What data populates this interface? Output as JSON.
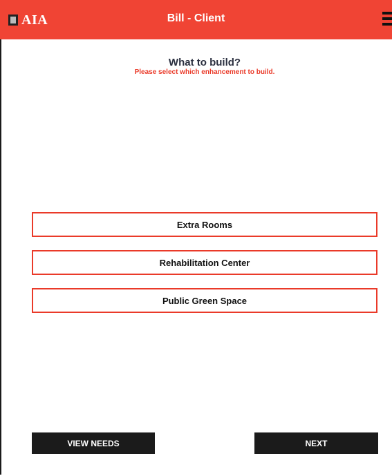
{
  "header": {
    "logo_text": "AIA",
    "title": "Bill - Client",
    "menu_icon": "hamburger-menu-icon",
    "background_color": "#f04434"
  },
  "prompt": {
    "heading": "What to build?",
    "subheading": "Please select which enhancement to build."
  },
  "options": [
    {
      "label": "Extra Rooms"
    },
    {
      "label": "Rehabilitation Center"
    },
    {
      "label": "Public Green Space"
    }
  ],
  "footer": {
    "view_needs_label": "VIEW NEEDS",
    "next_label": "NEXT"
  },
  "colors": {
    "accent": "#ea3a29",
    "dark": "#1b1b1b"
  }
}
